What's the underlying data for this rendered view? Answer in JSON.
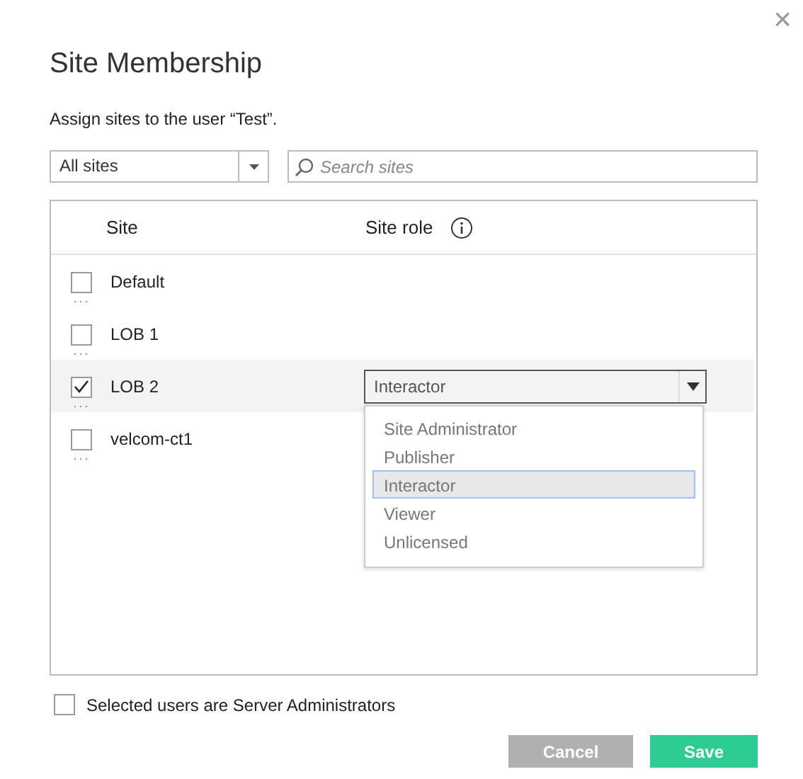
{
  "dialog": {
    "title": "Site Membership",
    "subtitle": "Assign sites to the user “Test”.",
    "close": "×"
  },
  "filter": {
    "value": "All sites"
  },
  "search": {
    "placeholder": "Search sites"
  },
  "table": {
    "columns": [
      "Site",
      "Site role"
    ],
    "rows": [
      {
        "name": "Default",
        "checked": false,
        "selected": false
      },
      {
        "name": "LOB 1",
        "checked": false,
        "selected": false
      },
      {
        "name": "LOB 2",
        "checked": true,
        "selected": true,
        "role": "Interactor",
        "menu": [
          {
            "label": "Site Administrator",
            "selected": false
          },
          {
            "label": "Publisher",
            "selected": false
          },
          {
            "label": "Interactor",
            "selected": true
          },
          {
            "label": "Viewer",
            "selected": false
          },
          {
            "label": "Unlicensed",
            "selected": false
          }
        ]
      },
      {
        "name": "velcom-ct1",
        "checked": false,
        "selected": false
      }
    ]
  },
  "server_admin": {
    "label": "Selected users are Server Administrators",
    "checked": false
  },
  "buttons": [
    {
      "label": "Cancel",
      "kind": "secondary"
    },
    {
      "label": "Save",
      "kind": "primary"
    }
  ]
}
